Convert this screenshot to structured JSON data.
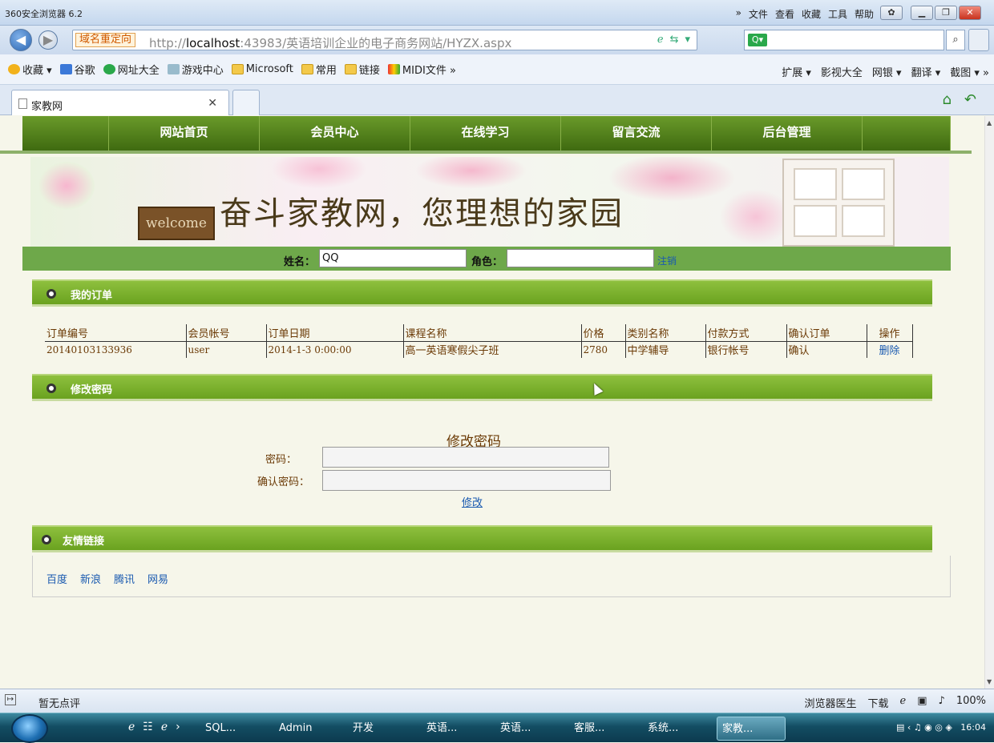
{
  "browser": {
    "title": "360安全浏览器 6.2",
    "top_menu": [
      "»",
      "文件",
      "查看",
      "收藏",
      "工具",
      "帮助"
    ],
    "redirect_label": "域名重定向",
    "url_host_prefix": "http://",
    "url_host": "localhost",
    "url_rest": ":43983/英语培训企业的电子商务网站/HYZX.aspx",
    "favorites": [
      {
        "label": "收藏 ▾"
      },
      {
        "label": "谷歌"
      },
      {
        "label": "网址大全"
      },
      {
        "label": "游戏中心"
      },
      {
        "label": "Microsoft"
      },
      {
        "label": "常用"
      },
      {
        "label": "链接"
      },
      {
        "label": "MIDI文件 »"
      }
    ],
    "fav_right": [
      "扩展 ▾",
      "影视大全",
      "网银 ▾",
      "翻译 ▾",
      "截图 ▾ »"
    ],
    "tab_label": "家教网",
    "status_left": "暂无点评",
    "status_right": [
      "浏览器医生",
      "下载",
      "100%"
    ]
  },
  "site": {
    "nav": [
      "网站首页",
      "会员中心",
      "在线学习",
      "留言交流",
      "后台管理"
    ],
    "banner_title": "奋斗家教网，您理想的家园",
    "banner_welcome": "welcome",
    "user": {
      "name_label": "姓名：",
      "name_value": "QQ",
      "role_label": "角色：",
      "role_value": "",
      "logout": "注销"
    },
    "orders": {
      "title": "我的订单",
      "headers": [
        "订单编号",
        "会员帐号",
        "订单日期",
        "课程名称",
        "价格",
        "类别名称",
        "付款方式",
        "确认订单",
        "操作"
      ],
      "rows": [
        [
          "20140103133936",
          "user",
          "2014-1-3 0:00:00",
          "高一英语寒假尖子班",
          "2780",
          "中学辅导",
          "银行帐号",
          "确认",
          "删除"
        ]
      ]
    },
    "password": {
      "section_title": "修改密码",
      "form_title": "修改密码",
      "pw_label": "密码：",
      "confirm_label": "确认密码：",
      "submit": "修改"
    },
    "links": {
      "title": "友情链接",
      "items": [
        "百度",
        "新浪",
        "腾讯",
        "网易"
      ]
    }
  },
  "taskbar": {
    "items": [
      "SQL...",
      "Admin",
      "开发",
      "英语...",
      "英语...",
      "客服...",
      "系统...",
      "家教..."
    ],
    "clock": "16:04"
  }
}
